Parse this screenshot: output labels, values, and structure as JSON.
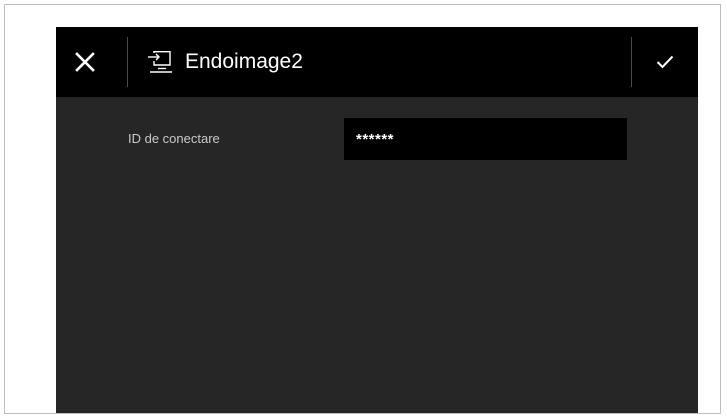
{
  "header": {
    "title": "Endoimage2",
    "close_icon": "close-icon",
    "device_icon": "input-device-icon",
    "confirm_icon": "checkmark-icon"
  },
  "form": {
    "connection_id": {
      "label": "ID de conectare",
      "value": "******"
    }
  },
  "colors": {
    "header_background": "#000000",
    "body_background": "#262626",
    "input_background": "#000000",
    "text_primary": "#ffffff",
    "text_label": "#c8c8c8"
  }
}
